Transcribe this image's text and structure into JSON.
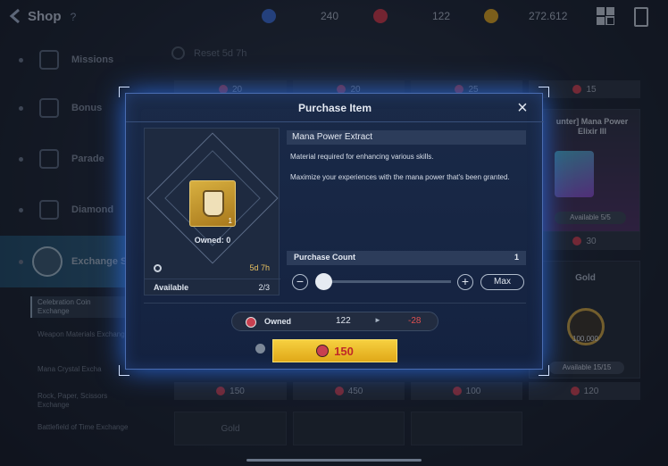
{
  "header": {
    "title": "Shop",
    "help": "?",
    "currencies": [
      {
        "icon": "blue-gem-icon",
        "value": "240",
        "color": "#3a6ad0"
      },
      {
        "icon": "red-crystal-icon",
        "value": "122",
        "color": "#c83848"
      },
      {
        "icon": "gold-coin-icon",
        "value": "272.612",
        "color": "#d8a020"
      }
    ]
  },
  "sidebar": {
    "items": [
      {
        "label": "Missions",
        "icon": "missions-icon"
      },
      {
        "label": "Bonus",
        "icon": "bonus-icon"
      },
      {
        "label": "Parade",
        "icon": "parade-icon"
      },
      {
        "label": "Diamond",
        "icon": "diamond-icon"
      },
      {
        "label": "Exchange S",
        "icon": "exchange-icon"
      }
    ],
    "subitems": [
      "Celebration Coin Exchange",
      "Weapon Materials Exchange",
      "Mana Crystal Excha",
      "Rock, Paper, Scissors Exchange",
      "Battlefield of Time Exchange"
    ]
  },
  "shop": {
    "reset_label": "Reset 5d 7h",
    "top_prices": [
      "20",
      "20",
      "25",
      "15"
    ],
    "side_card": {
      "title": "unter] Mana Power Elixir III",
      "availability": "Available 5/5",
      "price": "30"
    },
    "gold_card": {
      "title": "Gold",
      "amount": "100,000",
      "availability": "Available 15/15",
      "price": "120"
    },
    "bottom_prices": [
      "150",
      "450",
      "100",
      "120"
    ],
    "bottom_cards": [
      "Gold"
    ]
  },
  "modal": {
    "title": "Purchase Item",
    "item_name": "Mana Power Extract",
    "description_1": "Material required for enhancing various skills.",
    "description_2": "Maximize your experiences with the mana power that's been granted.",
    "item_quantity": "1",
    "owned_count": "Owned: 0",
    "timer": "5d 7h",
    "available_label": "Available",
    "available_value": "2/3",
    "purchase_count_label": "Purchase Count",
    "purchase_count": "1",
    "slider_fraction": 0.0,
    "max_label": "Max",
    "minus": "−",
    "plus": "+",
    "owned_label": "Owned",
    "owned_value": "122",
    "owned_delta": "-28",
    "buy_price": "150",
    "close": "×"
  }
}
